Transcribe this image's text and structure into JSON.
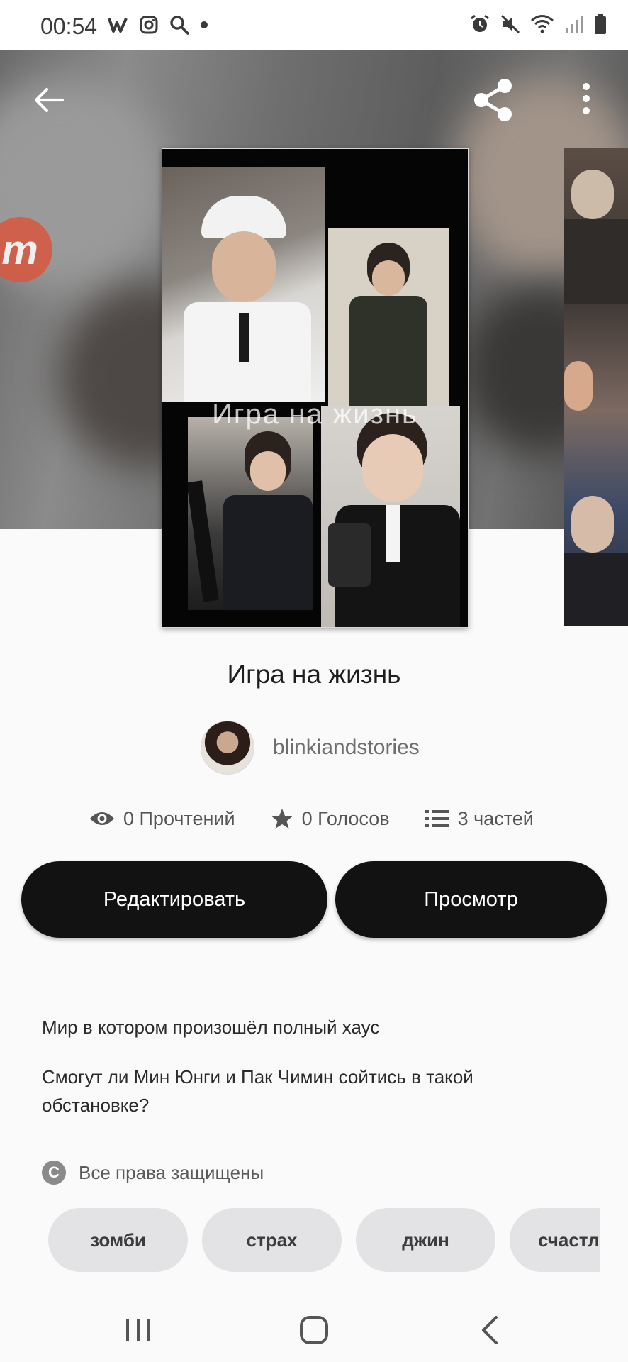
{
  "status_bar": {
    "time": "00:54",
    "left_icons": [
      "wattpad-w-icon",
      "instagram-icon",
      "search-icon",
      "dot-icon"
    ],
    "right_icons": [
      "alarm-icon",
      "mute-icon",
      "wifi-icon",
      "signal-icon",
      "battery-icon"
    ]
  },
  "header": {
    "back_icon": "arrow-left-icon",
    "share_icon": "share-icon",
    "more_icon": "vertical-dots-icon",
    "side_badge_text": "m"
  },
  "cover": {
    "overlay_title": "Игра на жизнь"
  },
  "story": {
    "title": "Игра на жизнь",
    "author": "blinkiandstories",
    "stats": {
      "reads": "0 Прочтений",
      "votes": "0 Голосов",
      "parts": "3 частей"
    }
  },
  "actions": {
    "edit_label": "Редактировать",
    "view_label": "Просмотр"
  },
  "description": {
    "line1": "Мир в котором произошёл полный хаус",
    "line2": "Смогут ли Мин Юнги и Пак Чимин сойтись в такой обстановке?"
  },
  "copyright": {
    "symbol": "C",
    "text": "Все права защищены"
  },
  "tags": [
    "зомби",
    "страх",
    "джин",
    "счастли"
  ],
  "nav": {
    "recents_icon": "recents-icon",
    "home_icon": "home-icon",
    "back_icon": "back-chevron-icon"
  },
  "colors": {
    "button_bg": "#121212",
    "tag_bg": "#e3e2e4",
    "badge": "#d9583f"
  }
}
